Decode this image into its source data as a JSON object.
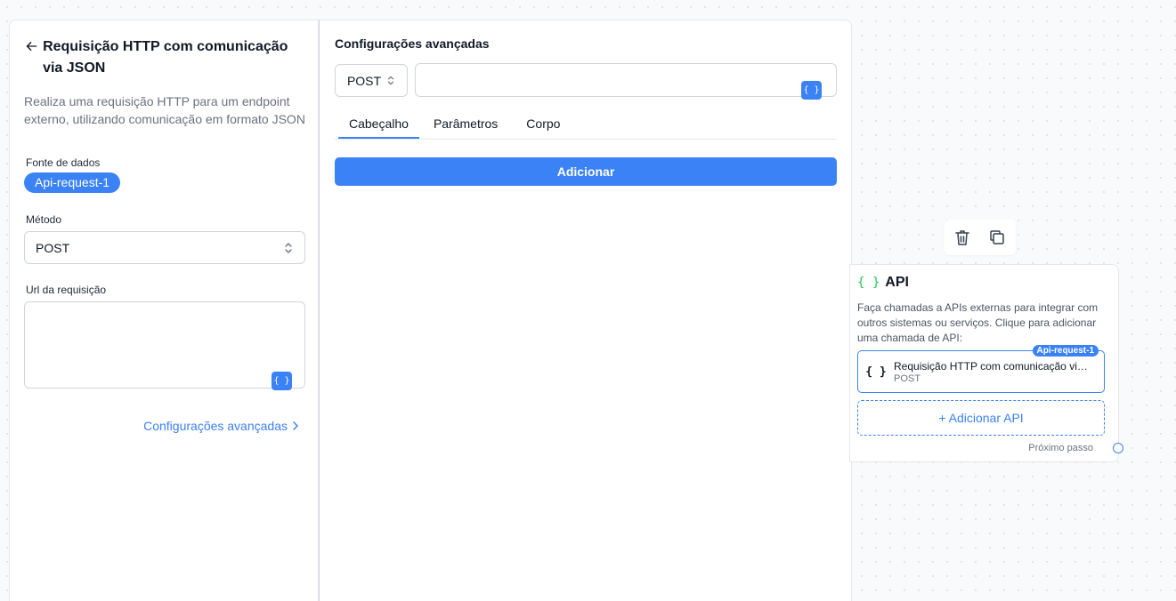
{
  "left_panel": {
    "title": "Requisição HTTP com comunicação via JSON",
    "description": "Realiza uma requisição HTTP para um endpoint externo, utilizando comunicação em formato JSON",
    "data_source_label": "Fonte de dados",
    "data_source_value": "Api-request-1",
    "method_label": "Método",
    "method_value": "POST",
    "url_label": "Url da requisição",
    "url_value": "",
    "variable_button": "{ }",
    "advanced_link": "Configurações avançadas"
  },
  "advanced_panel": {
    "title": "Configurações avançadas",
    "method_value": "POST",
    "url_value": "",
    "variable_button": "{ }",
    "tabs": [
      {
        "label": "Cabeçalho",
        "active": true
      },
      {
        "label": "Parâmetros",
        "active": false
      },
      {
        "label": "Corpo",
        "active": false
      }
    ],
    "add_button": "Adicionar"
  },
  "node": {
    "brace": "{ }",
    "title": "API",
    "description": "Faça chamadas a APIs externas para integrar com outros sistemas ou serviços. Clique para adicionar uma chamada de API:",
    "api_item": {
      "badge": "Api-request-1",
      "icon": "{ }",
      "name": "Requisição HTTP com comunicação via JSON",
      "method": "POST"
    },
    "add_api_button": "+ Adicionar API",
    "next_step": "Próximo passo"
  },
  "colors": {
    "accent": "#3b82f6",
    "brace_green": "#22c55e"
  }
}
